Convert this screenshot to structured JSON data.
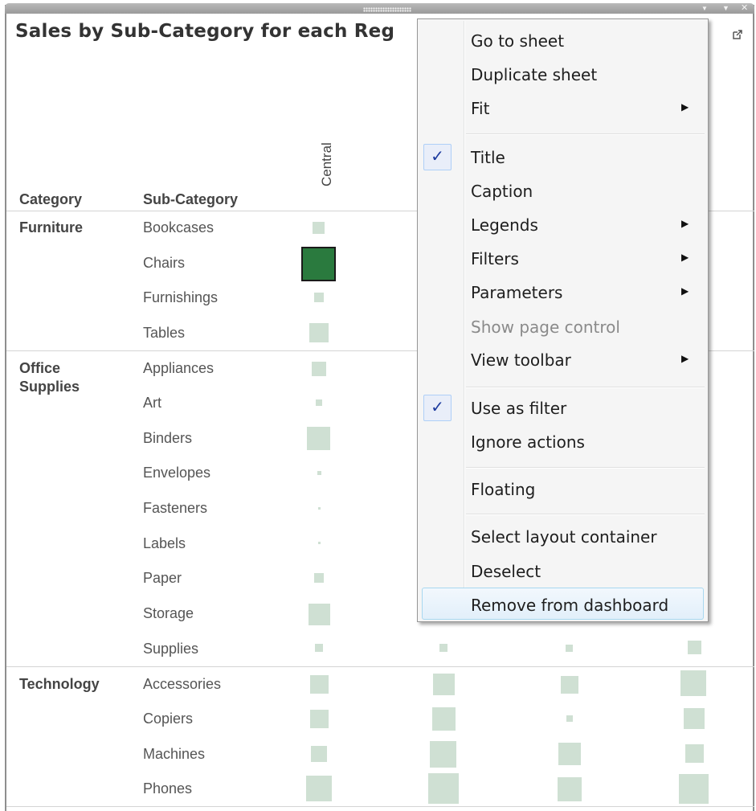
{
  "dashboard": {
    "title": "Sales by Sub-Category for each Reg",
    "icons": {
      "grip": "drag-grip-icon",
      "dropdown": "dropdown-arrow-icon",
      "filter": "filter-funnel-icon",
      "close": "close-icon",
      "popout": "popout-icon"
    }
  },
  "headers": {
    "category": "Category",
    "sub_category": "Sub-Category",
    "region": "Central"
  },
  "rows": {
    "furniture": {
      "label": "Furniture",
      "subs": [
        "Bookcases",
        "Chairs",
        "Furnishings",
        "Tables"
      ]
    },
    "office": {
      "label": "Office Supplies",
      "subs": [
        "Appliances",
        "Art",
        "Binders",
        "Envelopes",
        "Fasteners",
        "Labels",
        "Paper",
        "Storage",
        "Supplies"
      ]
    },
    "technology": {
      "label": "Technology",
      "subs": [
        "Accessories",
        "Copiers",
        "Machines",
        "Phones"
      ]
    }
  },
  "colors": {
    "mark": "#cfe0d3",
    "selected_mark": "#2a7a3e",
    "menu_highlight": "#e2effa",
    "check": "#1c3a9e"
  },
  "menu": {
    "items": [
      {
        "label": "Go to sheet"
      },
      {
        "label": "Duplicate sheet"
      },
      {
        "label": "Fit",
        "submenu": true
      },
      {
        "label": "Title",
        "checked": true
      },
      {
        "label": "Caption"
      },
      {
        "label": "Legends",
        "submenu": true
      },
      {
        "label": "Filters",
        "submenu": true
      },
      {
        "label": "Parameters",
        "submenu": true
      },
      {
        "label": "Show page control",
        "disabled": true
      },
      {
        "label": "View toolbar",
        "submenu": true
      },
      {
        "label": "Use as filter",
        "checked": true
      },
      {
        "label": "Ignore actions"
      },
      {
        "label": "Floating"
      },
      {
        "label": "Select layout container"
      },
      {
        "label": "Deselect"
      },
      {
        "label": "Remove from dashboard",
        "highlighted": true
      }
    ],
    "check_glyph": "✓",
    "submenu_glyph": "▶"
  }
}
